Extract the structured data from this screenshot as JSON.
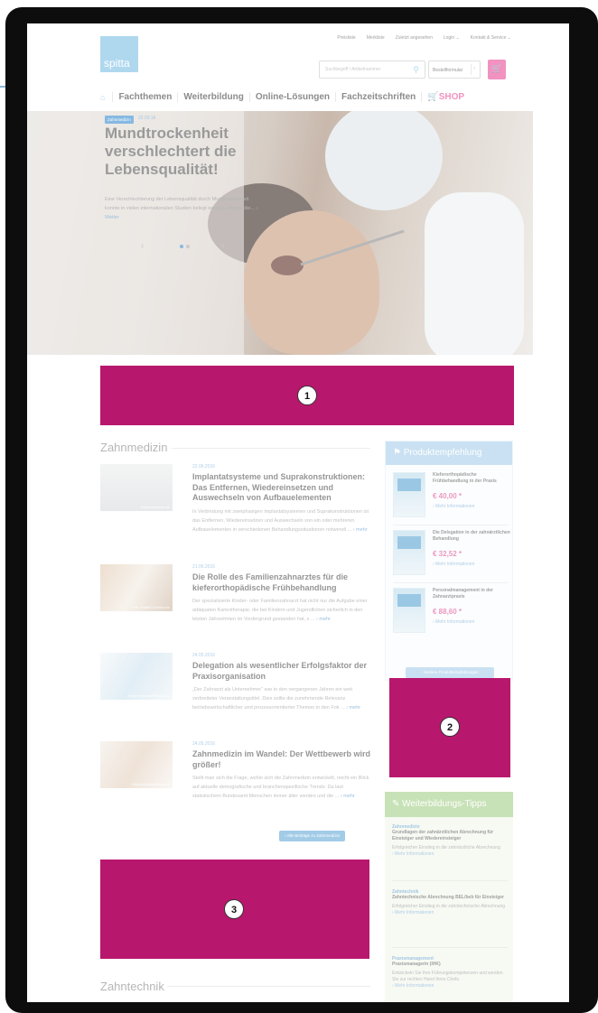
{
  "header": {
    "logo": "spitta",
    "top_links": [
      "Preisliste",
      "Merkliste",
      "Zuletzt angesehen",
      "Login ⌄",
      "Kontakt & Service ⌄"
    ],
    "search_placeholder": "Suchbegriff / Artikelnummer",
    "order_form_label": "Bestellformular",
    "order_form_arrow": "›",
    "cart_icon": "cart-icon"
  },
  "nav": {
    "home_icon": "home-icon",
    "items": [
      "Fachthemen",
      "Weiterbildung",
      "Online-Lösungen",
      "Fachzeitschriften"
    ],
    "shop": "SHOP"
  },
  "hero": {
    "badge": "Zahnmedizin",
    "date": "22.03.16",
    "title": "Mundtrockenheit verschlechtert die Lebensqualität!",
    "text": "Eine Verschlechterung der Lebensqualität durch Mundtrockenheit konnte in vielen internationalen Studien belegt werden, obwohl die...",
    "more": "› Weiter",
    "prev_arrow": "‹",
    "next_arrow": "›",
    "slide_count": 2,
    "active_slide": 1
  },
  "ads": [
    "1",
    "2",
    "3"
  ],
  "zahnmedizin": {
    "heading": "Zahnmedizin",
    "articles": [
      {
        "date": "22.06.2016",
        "title": "Implantatsysteme und Suprakonstruktionen: Das Entfernen, Wiedereinsetzen und Auswechseln von Aufbauelementen",
        "text": "In Verbindung mit zweiphasigen Implantatsystemen und Suprakonstruktionen ist das Entfernen, Wiedereinsetzen und Auswechseln von ein oder mehreren Aufbauelementen in verschiedenen Behandlungssituationen notwendi ...",
        "more": "› mehr",
        "caption": "Implantatsysteme.de"
      },
      {
        "date": "21.06.2016",
        "title": "Die Rolle des Familienzahnarztes für die kieferorthopädische Frühbehandlung",
        "text": "Der spezialisierte Kinder- oder Familienzahnarzt hat nicht nur die Aufgabe einer adäquaten Kariestherapie, die bei Kindern und Jugendlichen sicherlich in den letzten Jahrzehnten im Vordergrund gestanden hat, s ...",
        "more": "› mehr",
        "caption": "Foto: Fotolia/S.Kobold.com"
      },
      {
        "date": "24.05.2016",
        "title": "Delegation als wesentlicher Erfolgsfaktor der Praxisorganisation",
        "text": "„Der Zahnarzt als Unternehmer“ war in den vergangenen Jahren ein weit verbreiteter Veranstaltungstitel. Dies sollte die zunehmende Relevanz betriebswirtschaftlicher und prozessorientierter Themen in den Fok ...",
        "more": "› mehr",
        "caption": "Robert Kneschke/Fotolia.com"
      },
      {
        "date": "24.05.2016",
        "title": "Zahnmedizin im Wandel: Der Wettbewerb wird größer!",
        "text": "Stellt man sich die Frage, wohin sich die Zahnmedizin entwickelt, reicht ein Blick auf aktuelle demografische und branchenspezifische Trends: Da laut statistischem Bundesamt Menschen immer älter werden und die ...",
        "more": "› mehr",
        "caption": "Fotolia.com/grafikeule.com"
      }
    ],
    "all_button": "› Alle Beiträge zu Zahnmedizin"
  },
  "zahntechnik": {
    "heading": "Zahntechnik"
  },
  "produkt": {
    "heading": "Produktempfehlung",
    "items": [
      {
        "title": "Kieferorthopädische Frühbehandlung in der Praxis",
        "price": "€ 40,00 *",
        "more": "› Mehr Informationen"
      },
      {
        "title": "Die Delegation in der zahnärztlichen Behandlung",
        "price": "€ 32,52 *",
        "more": "› Mehr Informationen"
      },
      {
        "title": "Personalmanagement in der Zahnarztpraxis",
        "price": "€ 88,60 *",
        "more": "› Mehr Informationen"
      }
    ],
    "more_button": "› Weitere Produktempfehlungen"
  },
  "weiterbildung": {
    "heading": "Weiterbildungs-Tipps",
    "items": [
      {
        "category": "Zahnmedizin",
        "title": "Grundlagen der zahnärztlichen Abrechnung für Einsteiger und Wiedereinsteiger",
        "text": "Erfolgreicher Einstieg in die zahnärztliche Abrechnung",
        "more": "› Mehr Informationen"
      },
      {
        "category": "Zahntechnik",
        "title": "Zahntechnische Abrechnung BEL/beb für Einsteiger",
        "text": "Erfolgreicher Einstieg in die zahntechnische Abrechnung",
        "more": "› Mehr Informationen"
      },
      {
        "category": "Praxismanagement",
        "title": "Praxismanagerin (IHK)",
        "text": "Entwickeln Sie Ihre Führungskompetenzen und werden Sie zur rechten Hand Ihres Chefs.",
        "more": "› Mehr Informationen"
      }
    ]
  },
  "colors": {
    "accent": "#e8509b",
    "blue": "#7fc0e6",
    "ad": "#b8176e",
    "green": "#a7d08b"
  }
}
